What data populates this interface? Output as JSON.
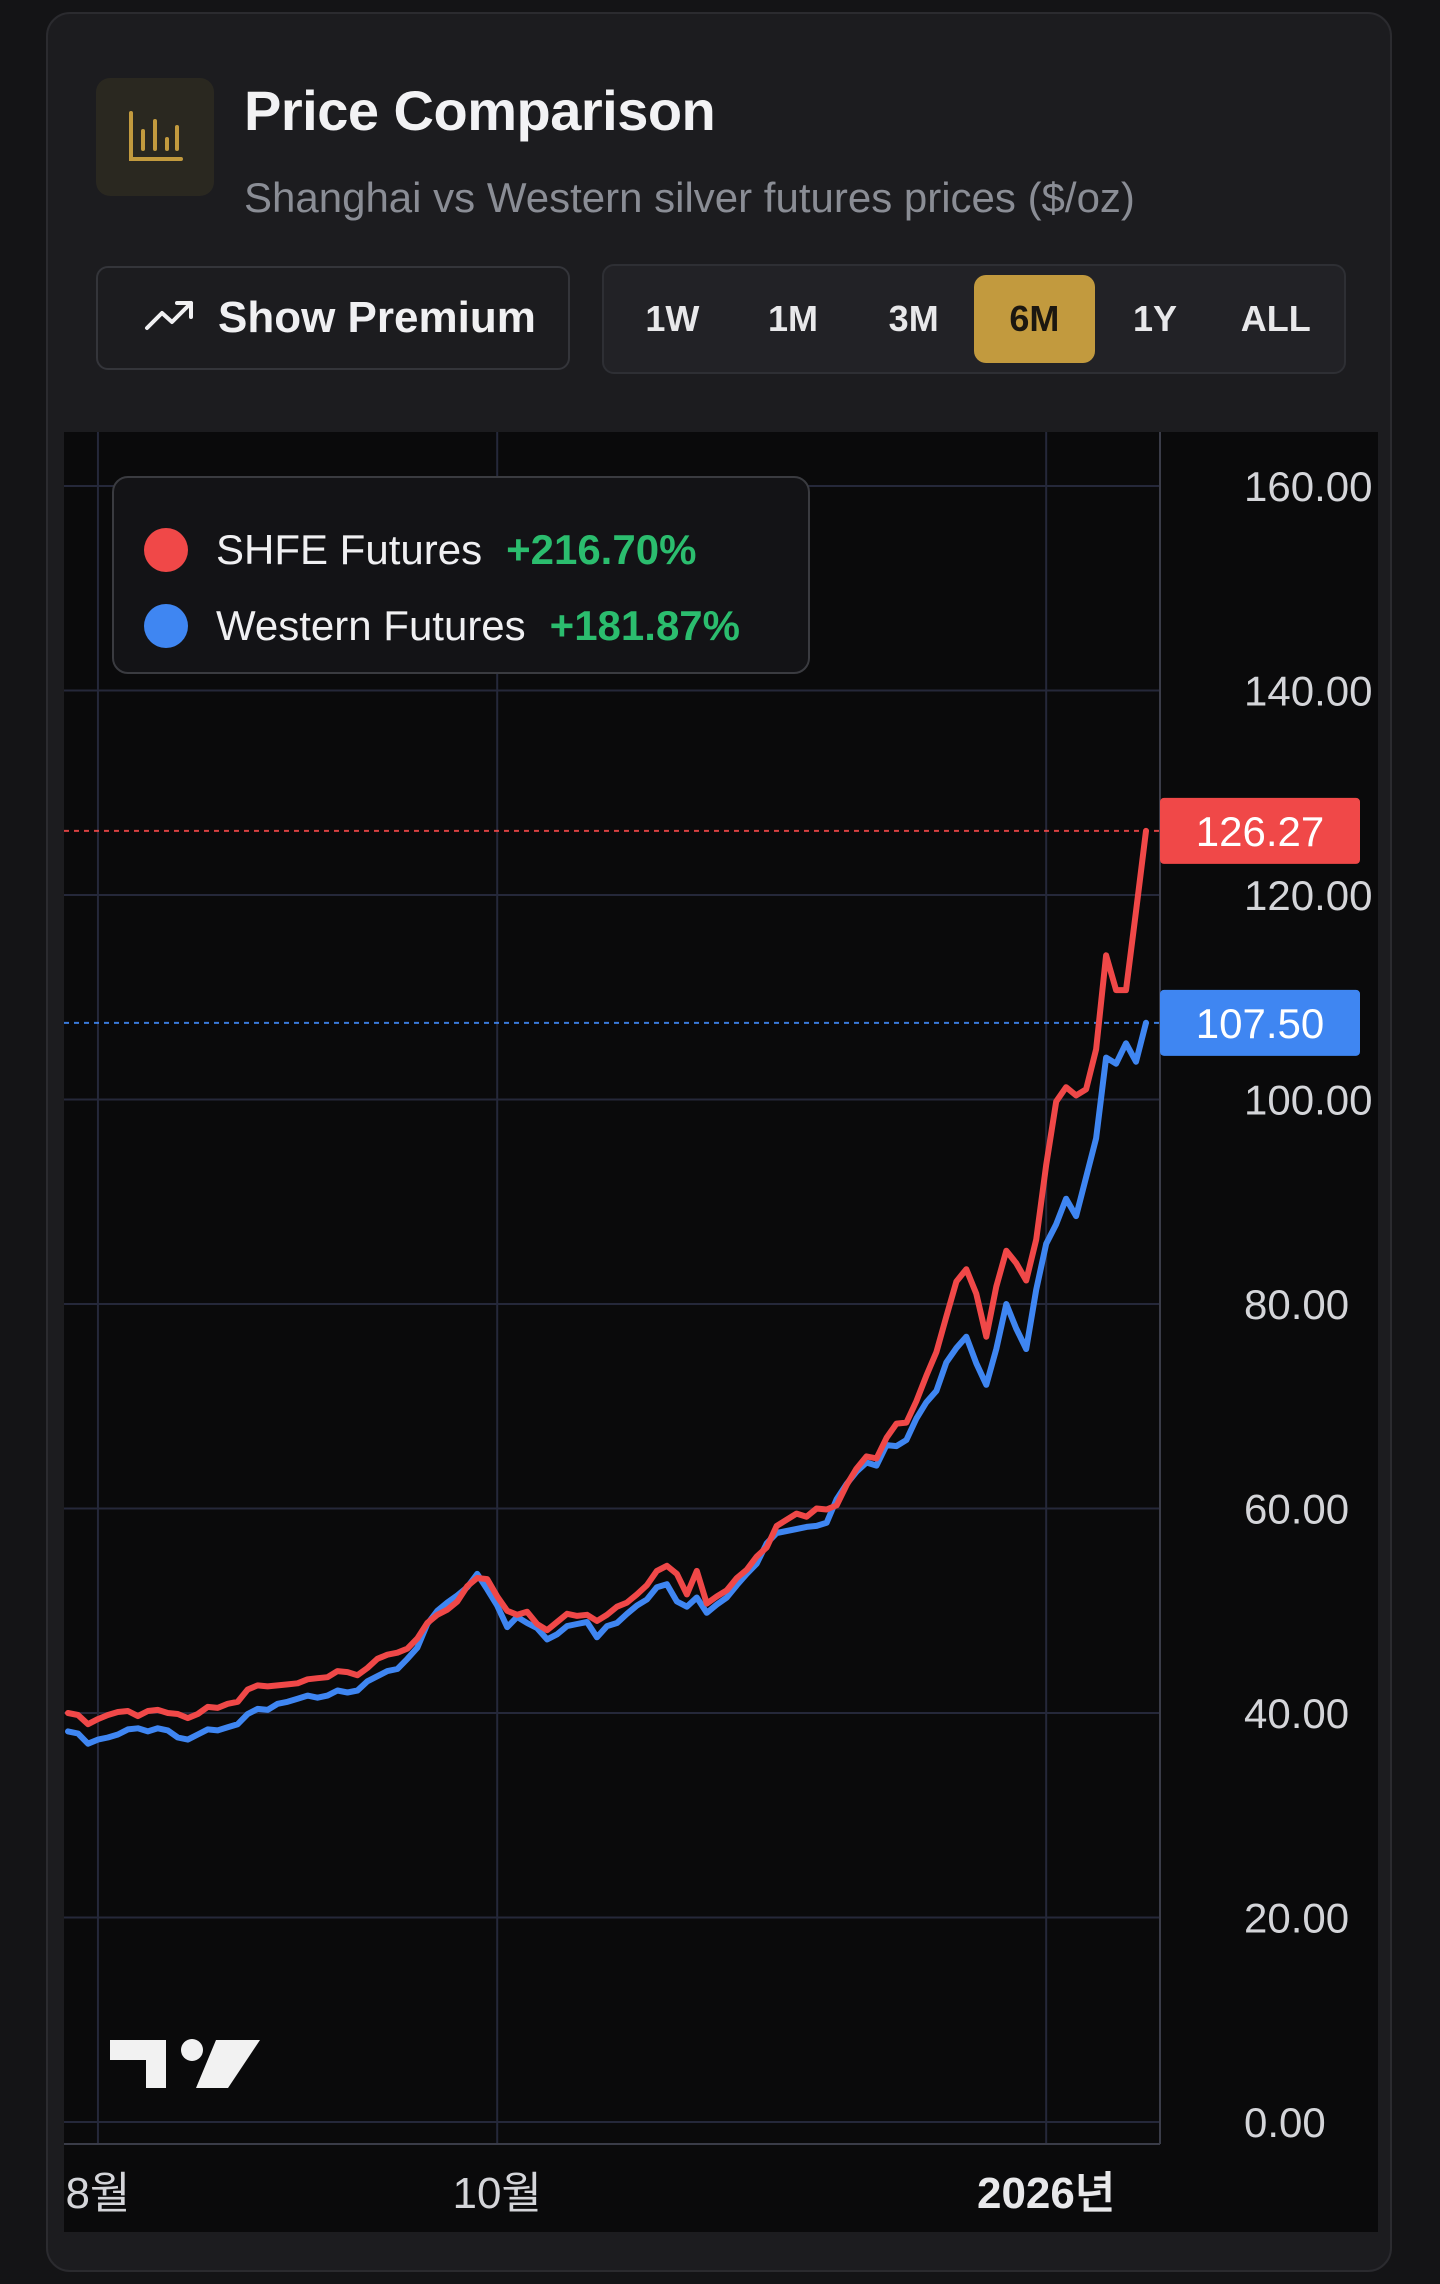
{
  "header": {
    "title": "Price Comparison",
    "subtitle": "Shanghai vs Western silver futures prices ($/oz)",
    "icon": "bar-chart-icon"
  },
  "controls": {
    "premium_label": "Show Premium",
    "premium_icon": "trending-up-icon",
    "ranges": [
      "1W",
      "1M",
      "3M",
      "6M",
      "1Y",
      "ALL"
    ],
    "active_range": "6M",
    "accent": "#c29a3e"
  },
  "legend": [
    {
      "name": "SHFE Futures",
      "change": "+216.70%",
      "color": "#f04848"
    },
    {
      "name": "Western Futures",
      "change": "+181.87%",
      "color": "#3f86f2"
    }
  ],
  "chart_data": {
    "type": "line",
    "ylim": [
      0,
      160
    ],
    "y_ticks": [
      "0.00",
      "20.00",
      "40.00",
      "60.00",
      "80.00",
      "100.00",
      "120.00",
      "140.00",
      "160.00"
    ],
    "x_ticks": [
      {
        "label": "8월",
        "index": 3,
        "bold": false
      },
      {
        "label": "10월",
        "index": 43,
        "bold": false
      },
      {
        "label": "2026년",
        "index": 98,
        "bold": true
      }
    ],
    "grid": true,
    "legend_position": "top-left",
    "last_values": [
      {
        "label": "126.27",
        "value": 126.27,
        "color": "#f04848"
      },
      {
        "label": "107.50",
        "value": 107.5,
        "color": "#3f86f2"
      }
    ],
    "series": [
      {
        "name": "SHFE Futures",
        "color": "#f04848",
        "values": [
          40.0,
          39.8,
          38.9,
          39.4,
          39.8,
          40.1,
          40.2,
          39.7,
          40.2,
          40.3,
          40.0,
          39.9,
          39.5,
          39.9,
          40.6,
          40.5,
          40.9,
          41.1,
          42.3,
          42.7,
          42.6,
          42.7,
          42.8,
          42.9,
          43.3,
          43.4,
          43.5,
          44.1,
          44.0,
          43.7,
          44.4,
          45.3,
          45.7,
          45.9,
          46.3,
          47.3,
          48.8,
          49.6,
          50.1,
          50.9,
          52.4,
          53.2,
          53.1,
          51.4,
          50.0,
          49.6,
          49.9,
          48.7,
          48.1,
          48.9,
          49.7,
          49.5,
          49.6,
          49.0,
          49.6,
          50.4,
          50.8,
          51.6,
          52.5,
          53.9,
          54.4,
          53.6,
          51.6,
          53.9,
          50.7,
          51.4,
          52.0,
          53.2,
          54.0,
          55.3,
          56.2,
          58.3,
          58.9,
          59.5,
          59.2,
          60.0,
          59.9,
          60.3,
          62.3,
          63.9,
          65.1,
          64.9,
          66.9,
          68.3,
          68.4,
          70.5,
          73.0,
          75.3,
          78.8,
          82.2,
          83.4,
          81.0,
          76.8,
          81.7,
          85.2,
          84.0,
          82.3,
          86.3,
          93.6,
          99.8,
          101.2,
          100.4,
          101.0,
          104.9,
          114.1,
          110.7,
          110.7,
          118.4,
          126.27
        ]
      },
      {
        "name": "Western Futures",
        "color": "#3f86f2",
        "values": [
          38.2,
          38.0,
          37.0,
          37.4,
          37.6,
          37.9,
          38.4,
          38.5,
          38.2,
          38.5,
          38.3,
          37.6,
          37.4,
          37.9,
          38.4,
          38.3,
          38.6,
          38.9,
          39.9,
          40.4,
          40.3,
          40.9,
          41.1,
          41.4,
          41.7,
          41.5,
          41.7,
          42.2,
          42.0,
          42.2,
          43.1,
          43.6,
          44.1,
          44.3,
          45.3,
          46.4,
          48.7,
          50.0,
          50.8,
          51.5,
          52.3,
          53.6,
          52.1,
          50.5,
          48.4,
          49.4,
          48.8,
          48.3,
          47.2,
          47.7,
          48.5,
          48.7,
          48.9,
          47.4,
          48.5,
          48.8,
          49.7,
          50.5,
          51.1,
          52.3,
          52.6,
          50.9,
          50.4,
          51.3,
          49.8,
          50.6,
          51.3,
          52.5,
          53.6,
          54.6,
          56.6,
          57.6,
          57.8,
          58.0,
          58.2,
          58.3,
          58.6,
          60.9,
          62.4,
          63.6,
          64.5,
          64.2,
          66.2,
          66.1,
          66.7,
          68.8,
          70.4,
          71.5,
          74.3,
          75.7,
          76.8,
          74.2,
          72.1,
          75.6,
          80.0,
          77.6,
          75.6,
          81.4,
          85.9,
          87.8,
          90.3,
          88.6,
          92.4,
          96.2,
          104.1,
          103.5,
          105.5,
          103.7,
          107.5
        ]
      }
    ]
  }
}
